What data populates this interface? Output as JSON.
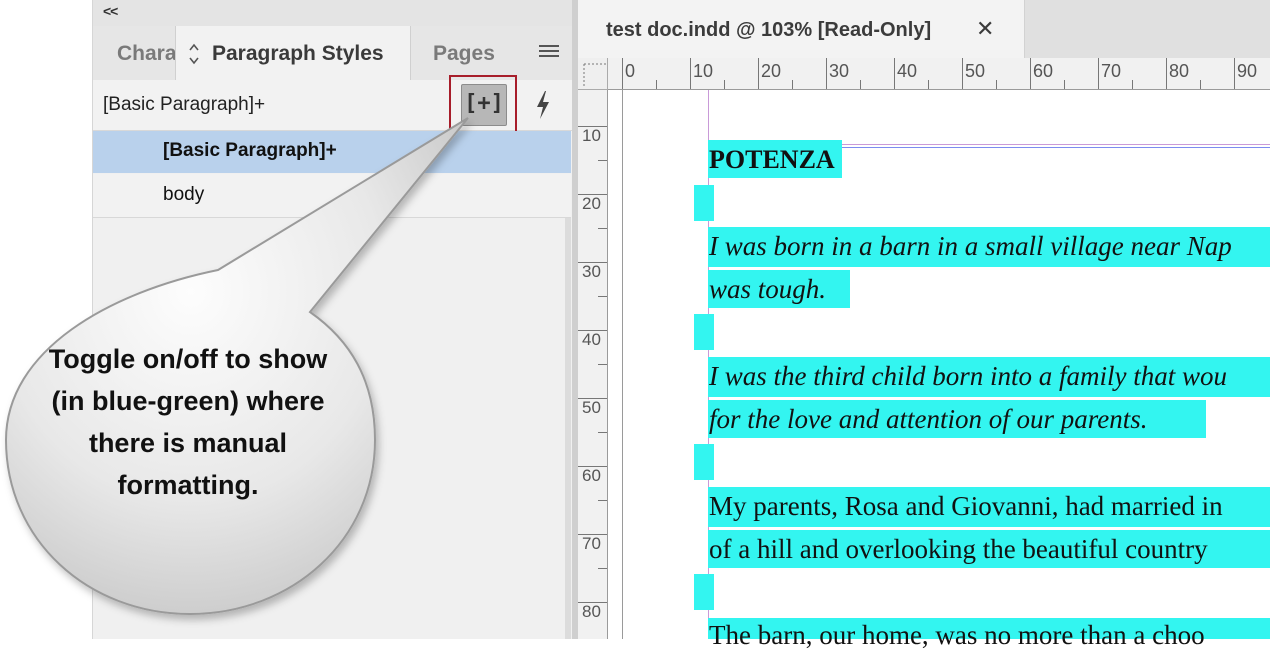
{
  "panel": {
    "collapse_label": "<<",
    "tabs": [
      {
        "label": "Chara"
      },
      {
        "label": "Paragraph Styles",
        "chevron": "⌃⌄"
      },
      {
        "label": "Pages"
      }
    ],
    "current_style": "[Basic Paragraph]+",
    "toggle_icon": "[+]",
    "styles": [
      {
        "label": "[Basic Paragraph]+",
        "selected": true
      },
      {
        "label": "body",
        "selected": false
      }
    ]
  },
  "document": {
    "tab_title": "test doc.indd @ 103% [Read-Only]",
    "close_glyph": "✕",
    "ruler_h": [
      "0",
      "10",
      "20",
      "30",
      "40",
      "50",
      "60",
      "70",
      "80",
      "90"
    ],
    "ruler_v": [
      "10",
      "20",
      "30",
      "40",
      "50",
      "60",
      "70",
      "80"
    ],
    "lines": [
      "POTENZA",
      "I was born in a barn in a small village near Nap",
      "was tough.",
      "I was the third child born into a family that wou",
      "for the love and attention of our parents.",
      "My parents, Rosa and Giovanni, had married in",
      "of a hill and overlooking the beautiful country",
      "The barn, our home, was no more than a choo"
    ],
    "highlight_color": "#33f5f0"
  },
  "callout": {
    "text": "Toggle on/off to show (in blue-green) where there is manual formatting."
  }
}
